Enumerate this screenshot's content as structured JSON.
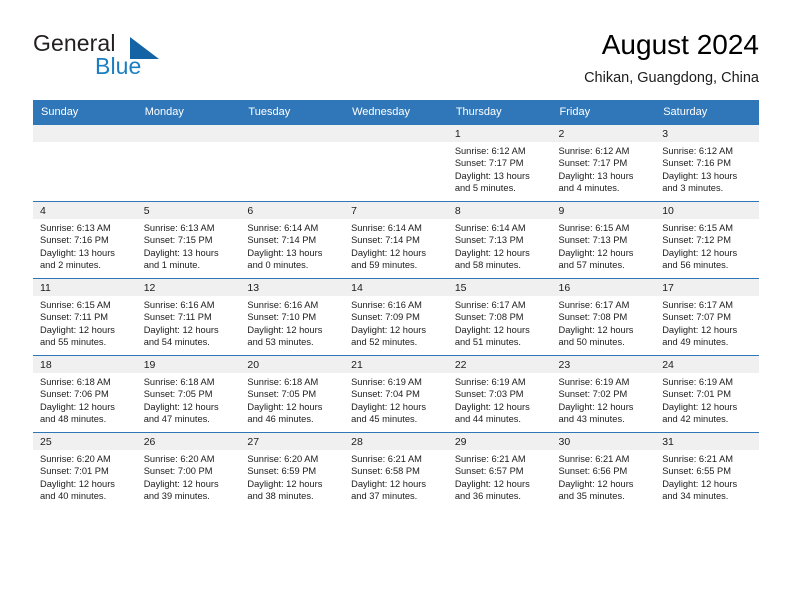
{
  "brand": {
    "name_part1": "General",
    "name_part2": "Blue",
    "logo_icon": "triangle-logo-icon",
    "accent_color": "#1464a5",
    "blue_text_color": "#1a7fc1"
  },
  "header": {
    "title": "August 2024",
    "location": "Chikan, Guangdong, China"
  },
  "calendar": {
    "header_background": "#3077b9",
    "daynum_background": "#f0f0f0",
    "weekday_headers": [
      "Sunday",
      "Monday",
      "Tuesday",
      "Wednesday",
      "Thursday",
      "Friday",
      "Saturday"
    ],
    "weeks": [
      [
        {
          "day": "",
          "empty": true,
          "sunrise": "",
          "sunset": "",
          "daylight_line1": "",
          "daylight_line2": ""
        },
        {
          "day": "",
          "empty": true,
          "sunrise": "",
          "sunset": "",
          "daylight_line1": "",
          "daylight_line2": ""
        },
        {
          "day": "",
          "empty": true,
          "sunrise": "",
          "sunset": "",
          "daylight_line1": "",
          "daylight_line2": ""
        },
        {
          "day": "",
          "empty": true,
          "sunrise": "",
          "sunset": "",
          "daylight_line1": "",
          "daylight_line2": ""
        },
        {
          "day": "1",
          "empty": false,
          "sunrise": "Sunrise: 6:12 AM",
          "sunset": "Sunset: 7:17 PM",
          "daylight_line1": "Daylight: 13 hours",
          "daylight_line2": "and 5 minutes."
        },
        {
          "day": "2",
          "empty": false,
          "sunrise": "Sunrise: 6:12 AM",
          "sunset": "Sunset: 7:17 PM",
          "daylight_line1": "Daylight: 13 hours",
          "daylight_line2": "and 4 minutes."
        },
        {
          "day": "3",
          "empty": false,
          "sunrise": "Sunrise: 6:12 AM",
          "sunset": "Sunset: 7:16 PM",
          "daylight_line1": "Daylight: 13 hours",
          "daylight_line2": "and 3 minutes."
        }
      ],
      [
        {
          "day": "4",
          "empty": false,
          "sunrise": "Sunrise: 6:13 AM",
          "sunset": "Sunset: 7:16 PM",
          "daylight_line1": "Daylight: 13 hours",
          "daylight_line2": "and 2 minutes."
        },
        {
          "day": "5",
          "empty": false,
          "sunrise": "Sunrise: 6:13 AM",
          "sunset": "Sunset: 7:15 PM",
          "daylight_line1": "Daylight: 13 hours",
          "daylight_line2": "and 1 minute."
        },
        {
          "day": "6",
          "empty": false,
          "sunrise": "Sunrise: 6:14 AM",
          "sunset": "Sunset: 7:14 PM",
          "daylight_line1": "Daylight: 13 hours",
          "daylight_line2": "and 0 minutes."
        },
        {
          "day": "7",
          "empty": false,
          "sunrise": "Sunrise: 6:14 AM",
          "sunset": "Sunset: 7:14 PM",
          "daylight_line1": "Daylight: 12 hours",
          "daylight_line2": "and 59 minutes."
        },
        {
          "day": "8",
          "empty": false,
          "sunrise": "Sunrise: 6:14 AM",
          "sunset": "Sunset: 7:13 PM",
          "daylight_line1": "Daylight: 12 hours",
          "daylight_line2": "and 58 minutes."
        },
        {
          "day": "9",
          "empty": false,
          "sunrise": "Sunrise: 6:15 AM",
          "sunset": "Sunset: 7:13 PM",
          "daylight_line1": "Daylight: 12 hours",
          "daylight_line2": "and 57 minutes."
        },
        {
          "day": "10",
          "empty": false,
          "sunrise": "Sunrise: 6:15 AM",
          "sunset": "Sunset: 7:12 PM",
          "daylight_line1": "Daylight: 12 hours",
          "daylight_line2": "and 56 minutes."
        }
      ],
      [
        {
          "day": "11",
          "empty": false,
          "sunrise": "Sunrise: 6:15 AM",
          "sunset": "Sunset: 7:11 PM",
          "daylight_line1": "Daylight: 12 hours",
          "daylight_line2": "and 55 minutes."
        },
        {
          "day": "12",
          "empty": false,
          "sunrise": "Sunrise: 6:16 AM",
          "sunset": "Sunset: 7:11 PM",
          "daylight_line1": "Daylight: 12 hours",
          "daylight_line2": "and 54 minutes."
        },
        {
          "day": "13",
          "empty": false,
          "sunrise": "Sunrise: 6:16 AM",
          "sunset": "Sunset: 7:10 PM",
          "daylight_line1": "Daylight: 12 hours",
          "daylight_line2": "and 53 minutes."
        },
        {
          "day": "14",
          "empty": false,
          "sunrise": "Sunrise: 6:16 AM",
          "sunset": "Sunset: 7:09 PM",
          "daylight_line1": "Daylight: 12 hours",
          "daylight_line2": "and 52 minutes."
        },
        {
          "day": "15",
          "empty": false,
          "sunrise": "Sunrise: 6:17 AM",
          "sunset": "Sunset: 7:08 PM",
          "daylight_line1": "Daylight: 12 hours",
          "daylight_line2": "and 51 minutes."
        },
        {
          "day": "16",
          "empty": false,
          "sunrise": "Sunrise: 6:17 AM",
          "sunset": "Sunset: 7:08 PM",
          "daylight_line1": "Daylight: 12 hours",
          "daylight_line2": "and 50 minutes."
        },
        {
          "day": "17",
          "empty": false,
          "sunrise": "Sunrise: 6:17 AM",
          "sunset": "Sunset: 7:07 PM",
          "daylight_line1": "Daylight: 12 hours",
          "daylight_line2": "and 49 minutes."
        }
      ],
      [
        {
          "day": "18",
          "empty": false,
          "sunrise": "Sunrise: 6:18 AM",
          "sunset": "Sunset: 7:06 PM",
          "daylight_line1": "Daylight: 12 hours",
          "daylight_line2": "and 48 minutes."
        },
        {
          "day": "19",
          "empty": false,
          "sunrise": "Sunrise: 6:18 AM",
          "sunset": "Sunset: 7:05 PM",
          "daylight_line1": "Daylight: 12 hours",
          "daylight_line2": "and 47 minutes."
        },
        {
          "day": "20",
          "empty": false,
          "sunrise": "Sunrise: 6:18 AM",
          "sunset": "Sunset: 7:05 PM",
          "daylight_line1": "Daylight: 12 hours",
          "daylight_line2": "and 46 minutes."
        },
        {
          "day": "21",
          "empty": false,
          "sunrise": "Sunrise: 6:19 AM",
          "sunset": "Sunset: 7:04 PM",
          "daylight_line1": "Daylight: 12 hours",
          "daylight_line2": "and 45 minutes."
        },
        {
          "day": "22",
          "empty": false,
          "sunrise": "Sunrise: 6:19 AM",
          "sunset": "Sunset: 7:03 PM",
          "daylight_line1": "Daylight: 12 hours",
          "daylight_line2": "and 44 minutes."
        },
        {
          "day": "23",
          "empty": false,
          "sunrise": "Sunrise: 6:19 AM",
          "sunset": "Sunset: 7:02 PM",
          "daylight_line1": "Daylight: 12 hours",
          "daylight_line2": "and 43 minutes."
        },
        {
          "day": "24",
          "empty": false,
          "sunrise": "Sunrise: 6:19 AM",
          "sunset": "Sunset: 7:01 PM",
          "daylight_line1": "Daylight: 12 hours",
          "daylight_line2": "and 42 minutes."
        }
      ],
      [
        {
          "day": "25",
          "empty": false,
          "sunrise": "Sunrise: 6:20 AM",
          "sunset": "Sunset: 7:01 PM",
          "daylight_line1": "Daylight: 12 hours",
          "daylight_line2": "and 40 minutes."
        },
        {
          "day": "26",
          "empty": false,
          "sunrise": "Sunrise: 6:20 AM",
          "sunset": "Sunset: 7:00 PM",
          "daylight_line1": "Daylight: 12 hours",
          "daylight_line2": "and 39 minutes."
        },
        {
          "day": "27",
          "empty": false,
          "sunrise": "Sunrise: 6:20 AM",
          "sunset": "Sunset: 6:59 PM",
          "daylight_line1": "Daylight: 12 hours",
          "daylight_line2": "and 38 minutes."
        },
        {
          "day": "28",
          "empty": false,
          "sunrise": "Sunrise: 6:21 AM",
          "sunset": "Sunset: 6:58 PM",
          "daylight_line1": "Daylight: 12 hours",
          "daylight_line2": "and 37 minutes."
        },
        {
          "day": "29",
          "empty": false,
          "sunrise": "Sunrise: 6:21 AM",
          "sunset": "Sunset: 6:57 PM",
          "daylight_line1": "Daylight: 12 hours",
          "daylight_line2": "and 36 minutes."
        },
        {
          "day": "30",
          "empty": false,
          "sunrise": "Sunrise: 6:21 AM",
          "sunset": "Sunset: 6:56 PM",
          "daylight_line1": "Daylight: 12 hours",
          "daylight_line2": "and 35 minutes."
        },
        {
          "day": "31",
          "empty": false,
          "sunrise": "Sunrise: 6:21 AM",
          "sunset": "Sunset: 6:55 PM",
          "daylight_line1": "Daylight: 12 hours",
          "daylight_line2": "and 34 minutes."
        }
      ]
    ]
  }
}
